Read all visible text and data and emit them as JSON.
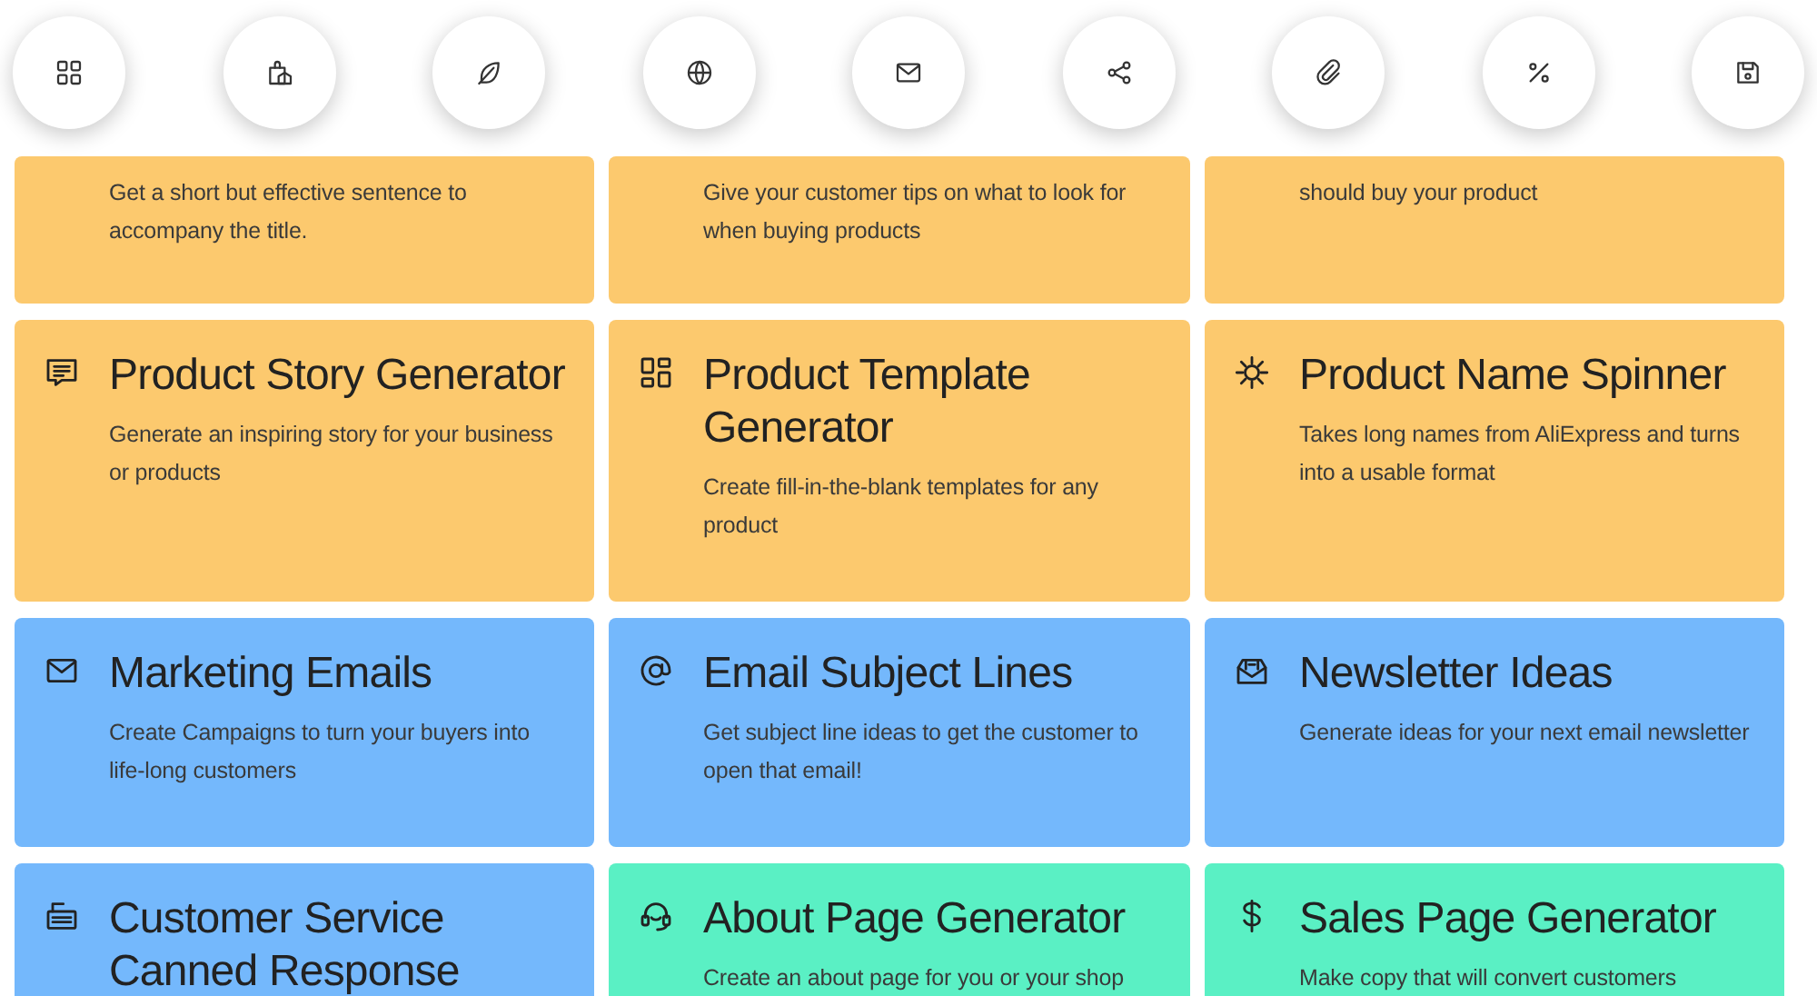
{
  "toolbar": [
    {
      "kind": "grid"
    },
    {
      "kind": "bag"
    },
    {
      "kind": "feather"
    },
    {
      "kind": "globe"
    },
    {
      "kind": "mail"
    },
    {
      "kind": "share"
    },
    {
      "kind": "clip"
    },
    {
      "kind": "percent"
    },
    {
      "kind": "save"
    }
  ],
  "cards": [
    {
      "color": "#fcc96e",
      "description": "Get a short but effective sentence to accompany the title."
    },
    {
      "color": "#fcc96e",
      "description": "Give your customer tips on what to look for when buying products"
    },
    {
      "color": "#fcc96e",
      "description": "should buy your product"
    },
    {
      "color": "#fcc96e",
      "kind": "message",
      "title": "Product Story Generator",
      "description": "Generate an inspiring story for your business or products"
    },
    {
      "color": "#fcc96e",
      "kind": "template",
      "title": "Product Template Generator",
      "description": "Create fill-in-the-blank templates for any product"
    },
    {
      "color": "#fcc96e",
      "kind": "sun",
      "title": "Product Name Spinner",
      "description": "Takes long names from AliExpress and turns into a usable format"
    },
    {
      "color": "#74b8fc",
      "kind": "mail",
      "title": "Marketing Emails",
      "description": "Create Campaigns to turn your buyers into life-long customers"
    },
    {
      "color": "#74b8fc",
      "kind": "at",
      "title": "Email Subject Lines",
      "description": "Get subject line ideas to get the customer to open that email!"
    },
    {
      "color": "#74b8fc",
      "kind": "newsletter",
      "title": "Newsletter Ideas",
      "description": "Generate ideas for your next email newsletter"
    },
    {
      "color": "#74b8fc",
      "kind": "register",
      "title": "Customer Service Canned Response"
    },
    {
      "color": "#5af0c4",
      "kind": "headset",
      "title": "About Page Generator",
      "description": "Create an about page for you or your shop"
    },
    {
      "color": "#5af0c4",
      "kind": "dollar",
      "title": "Sales Page Generator",
      "description": "Make copy that will convert customers"
    }
  ]
}
